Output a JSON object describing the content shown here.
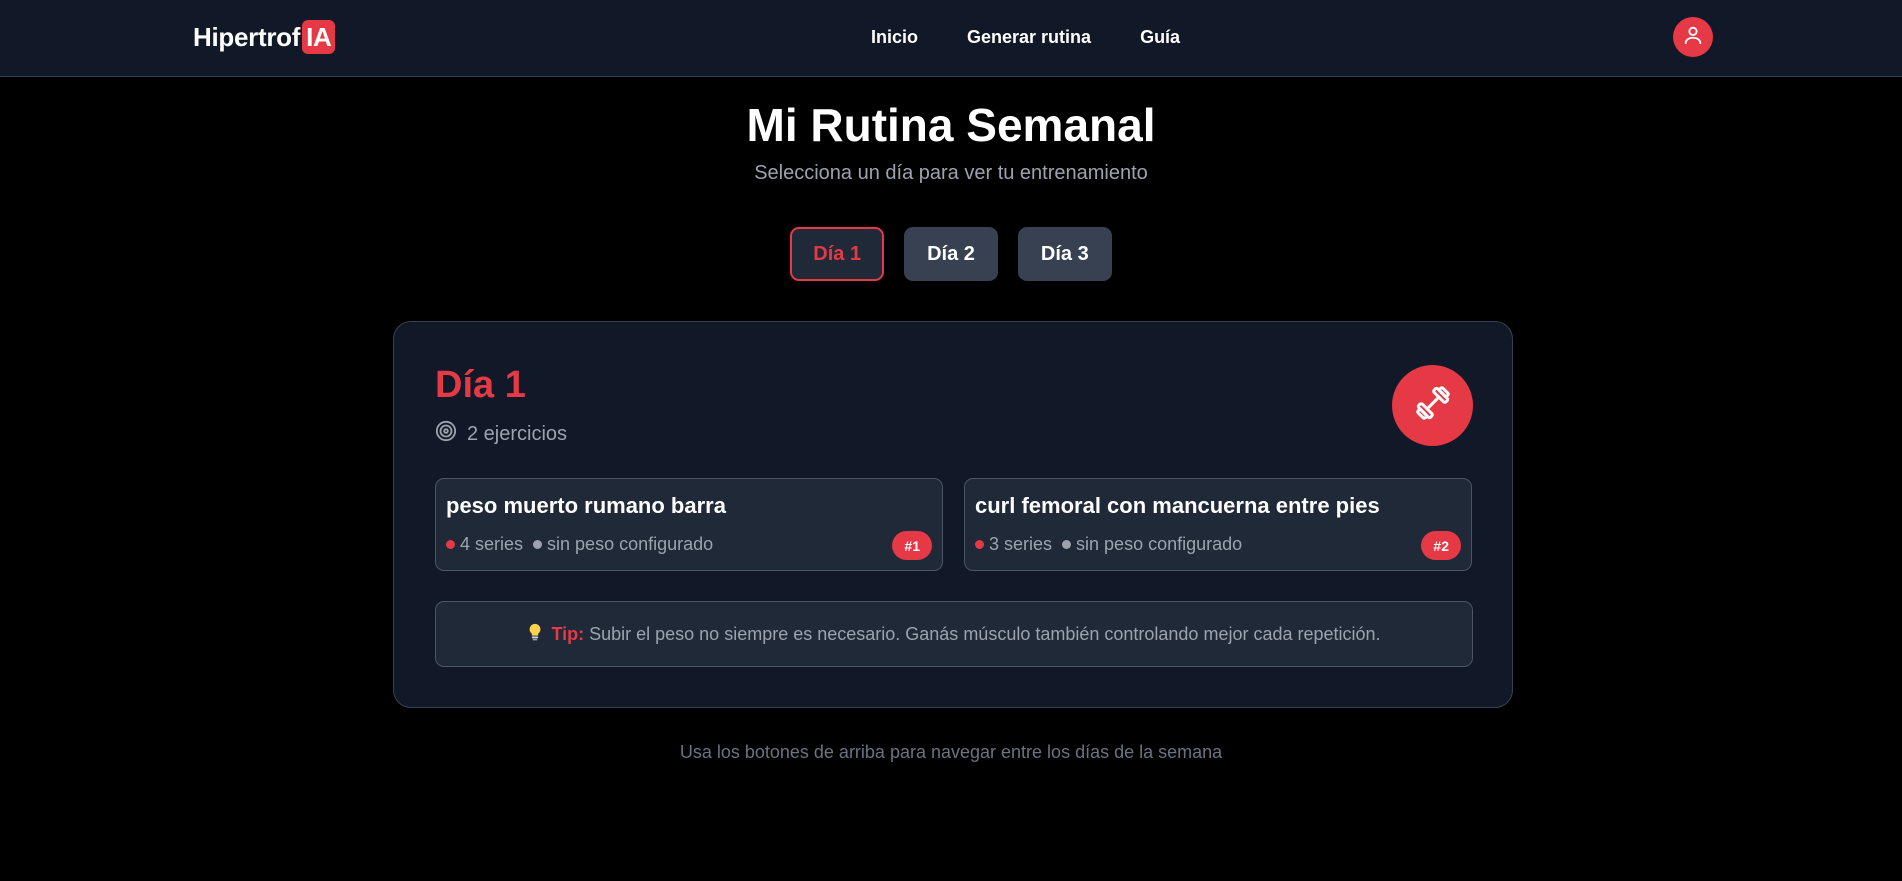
{
  "nav": {
    "logo_text": "Hipertrof",
    "logo_badge": "IA",
    "links": [
      "Inicio",
      "Generar rutina",
      "Guía"
    ],
    "user_icon": "user-icon"
  },
  "header": {
    "title": "Mi Rutina Semanal",
    "subtitle": "Selecciona un día para ver tu entrenamiento"
  },
  "tabs": [
    {
      "label": "Día 1",
      "active": true
    },
    {
      "label": "Día 2",
      "active": false
    },
    {
      "label": "Día 3",
      "active": false
    }
  ],
  "day": {
    "title": "Día 1",
    "count_icon": "target-icon",
    "count_text": "2 ejercicios",
    "icon": "dumbbell-icon",
    "exercises": [
      {
        "name": "peso muerto rumano barra",
        "series": "4 series",
        "weight": "sin peso configurado",
        "badge": "#1"
      },
      {
        "name": "curl femoral con mancuerna entre pies",
        "series": "3 series",
        "weight": "sin peso configurado",
        "badge": "#2"
      }
    ],
    "tip": {
      "icon": "lightbulb-icon",
      "label": "Tip:",
      "text": "Subir el peso no siempre es necesario. Ganás músculo también controlando mejor cada repetición."
    }
  },
  "footer_hint": "Usa los botones de arriba para navegar entre los días de la semana",
  "colors": {
    "accent": "#e63946",
    "nav_bg": "#111827",
    "card_bg": "#111827",
    "inner_bg": "#1f2937"
  }
}
